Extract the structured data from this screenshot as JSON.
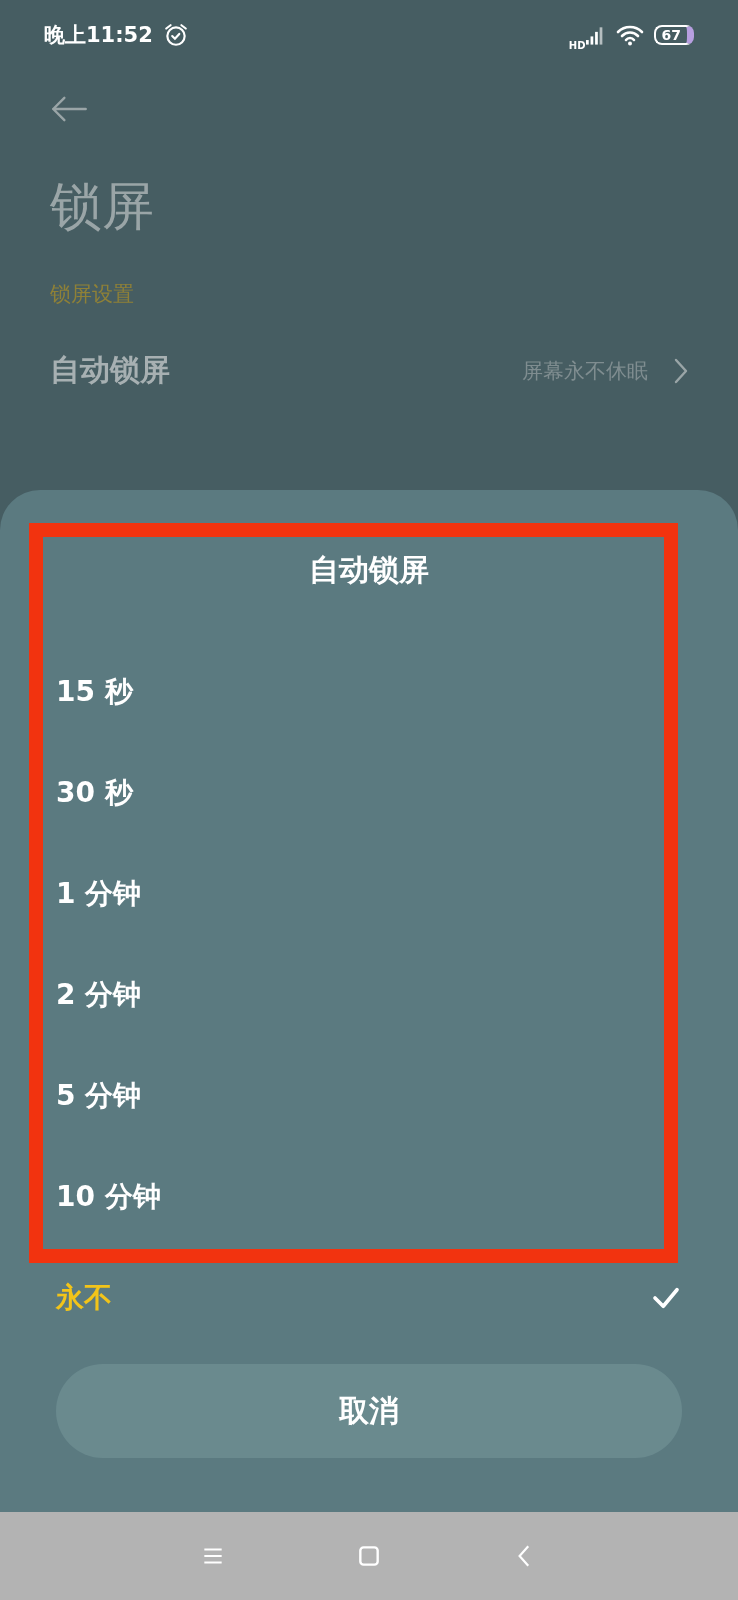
{
  "status_bar": {
    "time": "晚上11:52",
    "network": "HD",
    "battery": "67"
  },
  "page": {
    "title": "锁屏",
    "section": "锁屏设置",
    "rows": [
      {
        "label": "自动锁屏",
        "value": "屏幕永不休眠"
      }
    ]
  },
  "sheet": {
    "title": "自动锁屏",
    "options": [
      {
        "label": "15 秒",
        "selected": false
      },
      {
        "label": "30 秒",
        "selected": false
      },
      {
        "label": "1 分钟",
        "selected": false
      },
      {
        "label": "2 分钟",
        "selected": false
      },
      {
        "label": "5 分钟",
        "selected": false
      },
      {
        "label": "10 分钟",
        "selected": false
      },
      {
        "label": "永不",
        "selected": true
      }
    ],
    "cancel": "取消"
  }
}
